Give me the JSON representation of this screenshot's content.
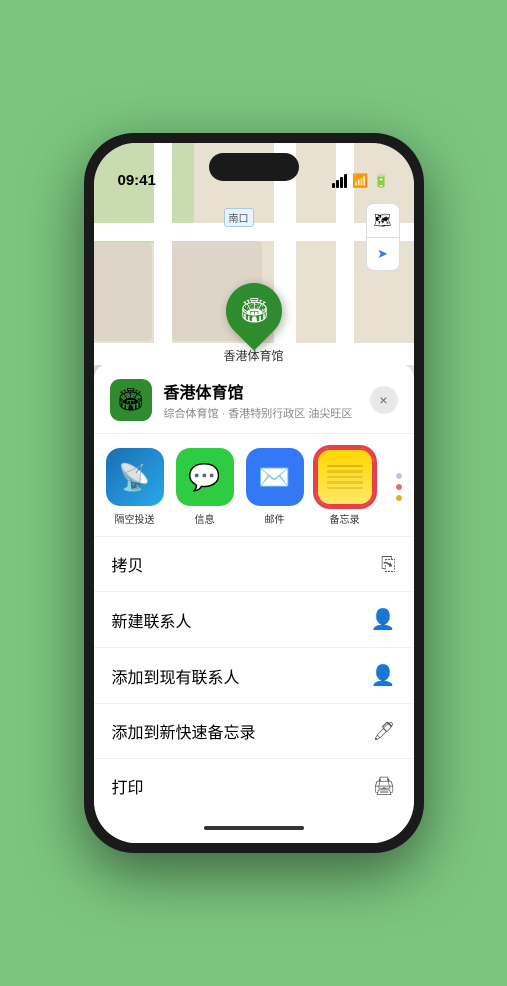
{
  "status": {
    "time": "09:41",
    "time_icon": "time-icon"
  },
  "map": {
    "label_text": "南口",
    "pin_label": "香港体育馆",
    "controls": {
      "map_btn": "🗺",
      "location_btn": "⬆"
    }
  },
  "venue": {
    "name": "香港体育馆",
    "description": "综合体育馆 · 香港特别行政区 油尖旺区",
    "icon": "🏟"
  },
  "share_items": [
    {
      "id": "airdrop",
      "label": "隔空投送",
      "type": "airdrop"
    },
    {
      "id": "messages",
      "label": "信息",
      "type": "messages"
    },
    {
      "id": "mail",
      "label": "邮件",
      "type": "mail"
    },
    {
      "id": "notes",
      "label": "备忘录",
      "type": "notes"
    }
  ],
  "actions": [
    {
      "id": "copy",
      "label": "拷贝",
      "icon": "📋"
    },
    {
      "id": "new-contact",
      "label": "新建联系人",
      "icon": "👤"
    },
    {
      "id": "add-existing",
      "label": "添加到现有联系人",
      "icon": "👤"
    },
    {
      "id": "add-note",
      "label": "添加到新快速备忘录",
      "icon": "🖊"
    },
    {
      "id": "print",
      "label": "打印",
      "icon": "🖨"
    }
  ],
  "close_label": "×"
}
